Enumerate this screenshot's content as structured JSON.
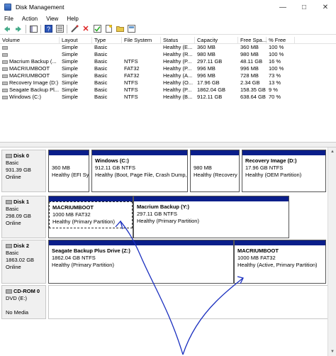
{
  "window": {
    "title": "Disk Management"
  },
  "menu": [
    "File",
    "Action",
    "View",
    "Help"
  ],
  "table": {
    "columns": [
      "Volume",
      "Layout",
      "Type",
      "File System",
      "Status",
      "Capacity",
      "Free Spa...",
      "% Free"
    ],
    "rows": [
      [
        "",
        "Simple",
        "Basic",
        "",
        "Healthy (E...",
        "360 MB",
        "360 MB",
        "100 %"
      ],
      [
        "",
        "Simple",
        "Basic",
        "",
        "Healthy (R...",
        "980 MB",
        "980 MB",
        "100 %"
      ],
      [
        "Macrium Backup (...",
        "Simple",
        "Basic",
        "NTFS",
        "Healthy (P...",
        "297.11 GB",
        "48.11 GB",
        "16 %"
      ],
      [
        "MACRIUMBOOT",
        "Simple",
        "Basic",
        "FAT32",
        "Healthy (P...",
        "996 MB",
        "996 MB",
        "100 %"
      ],
      [
        "MACRIUMBOOT",
        "Simple",
        "Basic",
        "FAT32",
        "Healthy (A...",
        "996 MB",
        "728 MB",
        "73 %"
      ],
      [
        "Recovery Image (D:)",
        "Simple",
        "Basic",
        "NTFS",
        "Healthy (O...",
        "17.96 GB",
        "2.34 GB",
        "13 %"
      ],
      [
        "Seagate Backup Pl...",
        "Simple",
        "Basic",
        "NTFS",
        "Healthy (P...",
        "1862.04 GB",
        "158.35 GB",
        "9 %"
      ],
      [
        "Windows (C:)",
        "Simple",
        "Basic",
        "NTFS",
        "Healthy (B...",
        "912.11 GB",
        "638.64 GB",
        "70 %"
      ]
    ]
  },
  "disks": [
    {
      "name": "Disk 0",
      "type": "Basic",
      "size": "931.39 GB",
      "status": "Online",
      "partitions": [
        {
          "name": "",
          "size": "360 MB",
          "status": "Healthy (EFI Sy:"
        },
        {
          "name": "Windows  (C:)",
          "size": "912.11 GB NTFS",
          "status": "Healthy (Boot, Page File, Crash Dump, F"
        },
        {
          "name": "",
          "size": "980 MB",
          "status": "Healthy (Recovery"
        },
        {
          "name": "Recovery Image  (D:)",
          "size": "17.96 GB NTFS",
          "status": "Healthy (OEM Partition)"
        }
      ]
    },
    {
      "name": "Disk 1",
      "type": "Basic",
      "size": "298.09 GB",
      "status": "Online",
      "partitions": [
        {
          "name": "MACRIUMBOOT",
          "size": "1000 MB FAT32",
          "status": "Healthy (Primary Partition)"
        },
        {
          "name": "Macrium Backup  (Y:)",
          "size": "297.11 GB NTFS",
          "status": "Healthy (Primary Partition)"
        }
      ]
    },
    {
      "name": "Disk 2",
      "type": "Basic",
      "size": "1863.02 GB",
      "status": "Online",
      "partitions": [
        {
          "name": "Seagate Backup Plus Drive  (Z:)",
          "size": "1862.04 GB NTFS",
          "status": "Healthy (Primary Partition)"
        },
        {
          "name": "MACRIUMBOOT",
          "size": "1000 MB FAT32",
          "status": "Healthy (Active, Primary Partition)"
        }
      ]
    },
    {
      "name": "CD-ROM 0",
      "type": "DVD (E:)",
      "size": "",
      "status": "No Media",
      "partitions": []
    }
  ],
  "colors": {
    "partition_bar": "#0a1e8a",
    "annotation": "#1a2fbf"
  },
  "icons": [
    "back-icon",
    "forward-icon",
    "console-tree-icon",
    "help-icon",
    "properties-icon",
    "connect-icon",
    "delete-icon",
    "check-icon",
    "new-icon",
    "open-folder-icon",
    "export-icon"
  ]
}
